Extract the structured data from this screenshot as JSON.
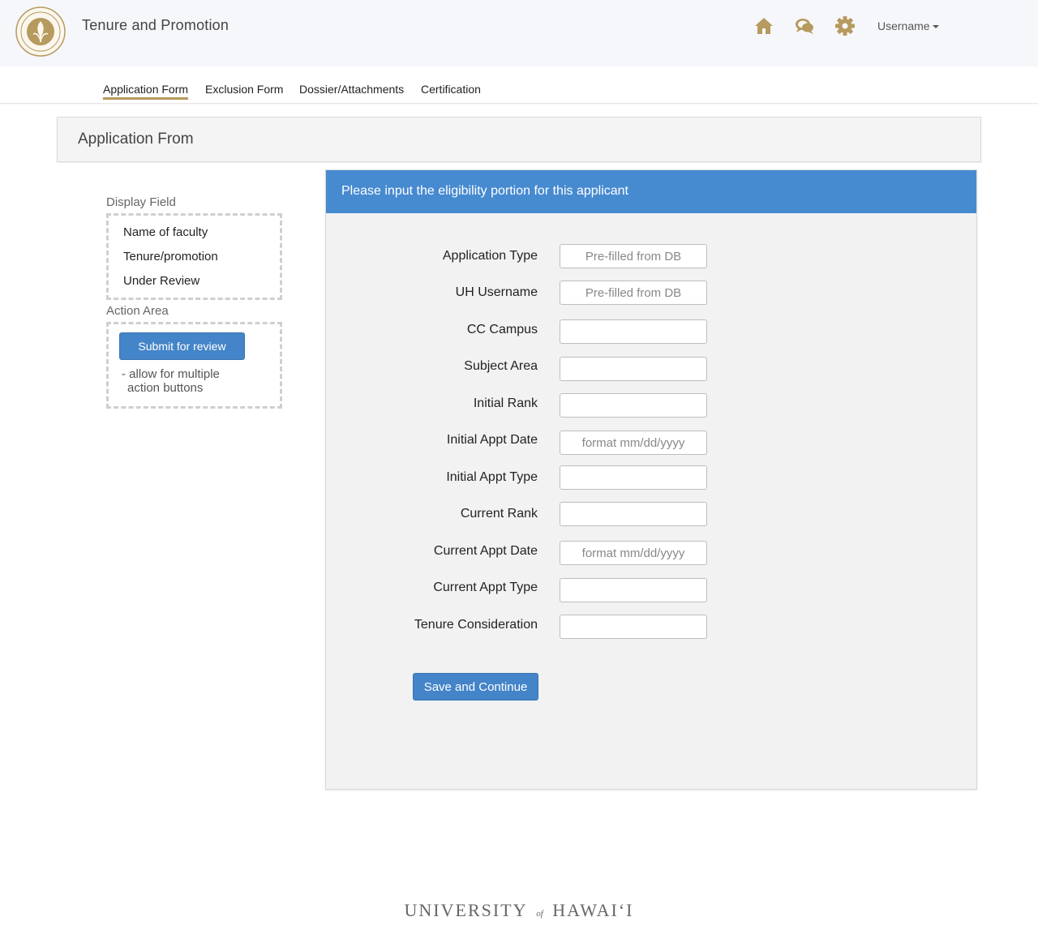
{
  "header": {
    "app_title": "Tenure and Promotion",
    "username": "Username",
    "accent_color": "#b69a5e",
    "icons": [
      "home-icon",
      "chat-icon",
      "gear-icon"
    ]
  },
  "tabs": [
    {
      "label": "Application Form",
      "active": true
    },
    {
      "label": "Exclusion Form",
      "active": false
    },
    {
      "label": "Dossier/Attachments",
      "active": false
    },
    {
      "label": "Certification",
      "active": false
    }
  ],
  "page": {
    "title": "Application From"
  },
  "sidebar": {
    "display_field_label": "Display Field",
    "display_items": [
      "Name of faculty",
      "Tenure/promotion",
      "Under Review"
    ],
    "action_area_label": "Action Area",
    "submit_button": "Submit for review",
    "note_line1": "- allow for multiple",
    "note_line2": "action buttons"
  },
  "form": {
    "header": "Please input the eligibility portion for this applicant",
    "header_color": "#468ad0",
    "fields": [
      {
        "label": "Application Type",
        "placeholder": "Pre-filled from DB",
        "value": ""
      },
      {
        "label": "UH Username",
        "placeholder": "Pre-filled from DB",
        "value": ""
      },
      {
        "label": "CC Campus",
        "placeholder": "",
        "value": ""
      },
      {
        "label": "Subject Area",
        "placeholder": "",
        "value": ""
      },
      {
        "label": "Initial Rank",
        "placeholder": "",
        "value": ""
      },
      {
        "label": "Initial Appt Date",
        "placeholder": "format mm/dd/yyyy",
        "value": ""
      },
      {
        "label": "Initial Appt Type",
        "placeholder": "",
        "value": ""
      },
      {
        "label": "Current Rank",
        "placeholder": "",
        "value": ""
      },
      {
        "label": "Current Appt Date",
        "placeholder": "format mm/dd/yyyy",
        "value": ""
      },
      {
        "label": "Current Appt Type",
        "placeholder": "",
        "value": ""
      },
      {
        "label": "Tenure Consideration",
        "placeholder": "",
        "value": ""
      }
    ],
    "save_button": "Save and Continue"
  },
  "footer": {
    "brand_left": "UNIVERSITY",
    "brand_of": "of",
    "brand_right": "HAWAI‘I"
  }
}
